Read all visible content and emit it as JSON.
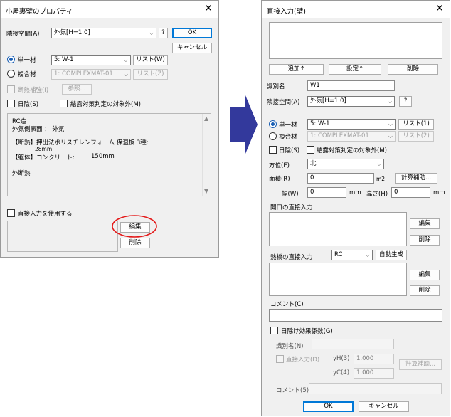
{
  "left_dialog": {
    "title": "小屋裏壁のプロパティ",
    "adjacent_label": "隣接空間(A)",
    "adjacent_value": "外気[H=1.0]",
    "help": "?",
    "ok": "OK",
    "cancel": "キャンセル",
    "single_label": "単一材",
    "single_value": "5: W-1",
    "list_label": "リスト(W)",
    "composite_label": "複合材",
    "composite_value": "1: COMPLEXMAT-01",
    "list_z_label": "リスト(Z)",
    "insulation_label": "断熱補強(I)",
    "browse_label": "参照...",
    "sunshade_label": "日陰(S)",
    "condensation_label": "結露対策判定の対象外(M)",
    "text_lines": [
      "RC造",
      "外気側表面 ： 外気",
      "【断熱】押出法ポリスチレンフォーム 保温板 3種:",
      "28mm",
      "【躯体】コンクリート:",
      "150mm",
      "外断熱"
    ],
    "direct_input_label": "直接入力を使用する",
    "edit_button": "編集",
    "delete_button": "削除"
  },
  "right_dialog": {
    "title": "直接入力(壁)",
    "add_button": "追加↑",
    "set_button": "設定↑",
    "delete_button": "削除",
    "name_label": "識別名",
    "name_value": "W1",
    "adjacent_label": "隣接空間(A)",
    "adjacent_value": "外気[H=1.0]",
    "help": "?",
    "single_label": "単一材",
    "single_value": "5: W-1",
    "list1_label": "リスト(1)",
    "composite_label": "複合材",
    "composite_value": "1: COMPLEXMAT-01",
    "list2_label": "リスト(2)",
    "sunshade_label": "日陰(S)",
    "condensation_label": "結露対策判定の対象外(M)",
    "direction_label": "方位(E)",
    "direction_value": "北",
    "area_label": "面積(R)",
    "area_value": "0",
    "area_unit": "m2",
    "area_calc_button": "計算補助...",
    "width_label": "幅(W)",
    "width_value": "0",
    "width_unit": "mm",
    "height_label": "高さ(H)",
    "height_value": "0",
    "height_unit": "mm",
    "opening_label": "開口の直接入力",
    "edit_button": "編集",
    "delete2_button": "削除",
    "thermal_bridge_label": "熱橋の直接入力",
    "thermal_bridge_value": "RC",
    "auto_generate_button": "自動生成",
    "edit2_button": "編集",
    "delete3_button": "削除",
    "comment_label": "コメント(C)",
    "shade_effect_label": "日除け効果係数(G)",
    "shade_name_label": "識別名(N)",
    "shade_direct_label": "直接入力(D)",
    "yh_label": "yH(3)",
    "yh_value": "1.000",
    "yc_label": "yC(4)",
    "yc_value": "1.000",
    "shade_calc_button": "計算補助...",
    "shade_comment_label": "コメント(5)",
    "ok": "OK",
    "cancel": "キャンセル"
  },
  "colors": {
    "arrow": "#33399c",
    "highlight": "#e41a1a",
    "accent": "#0078d7"
  },
  "icons": [
    "close-icon",
    "chevron-down-icon",
    "arrow-right-icon"
  ]
}
